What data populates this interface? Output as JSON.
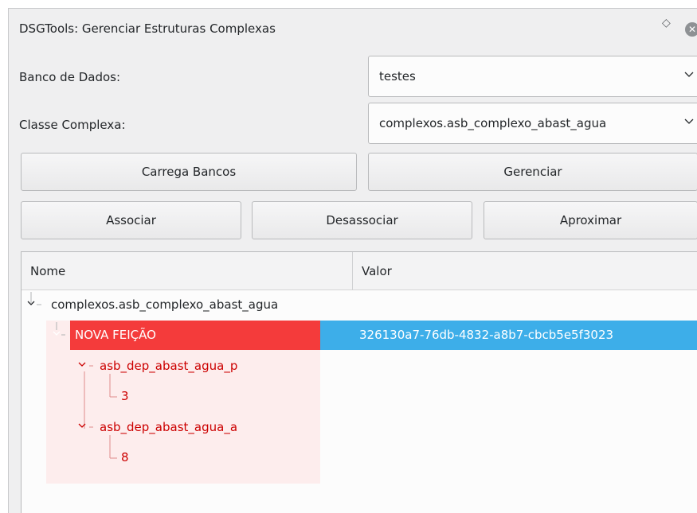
{
  "window": {
    "title": "DSGTools: Gerenciar Estruturas Complexas",
    "float_icon": "◇",
    "close_icon": "✕"
  },
  "form": {
    "database_label": "Banco de Dados:",
    "database_value": "testes",
    "class_label": "Classe Complexa:",
    "class_value": "complexos.asb_complexo_abast_agua"
  },
  "buttons": {
    "load": "Carrega Bancos",
    "manage": "Gerenciar",
    "associate": "Associar",
    "disassociate": "Desassociar",
    "zoom": "Aproximar"
  },
  "tree": {
    "col_name": "Nome",
    "col_value": "Valor",
    "root": "complexos.asb_complexo_abast_agua",
    "feature": {
      "name": "NOVA FEIÇÃO",
      "value": "326130a7-76db-4832-a8b7-cbcb5e5f3023"
    },
    "children": [
      {
        "name": "asb_dep_abast_agua_p",
        "leaf": "3"
      },
      {
        "name": "asb_dep_abast_agua_a",
        "leaf": "8"
      }
    ]
  },
  "colors": {
    "selection_red": "#f43b3b",
    "selection_blue": "#3daee9",
    "child_text_red": "#cc0000"
  }
}
